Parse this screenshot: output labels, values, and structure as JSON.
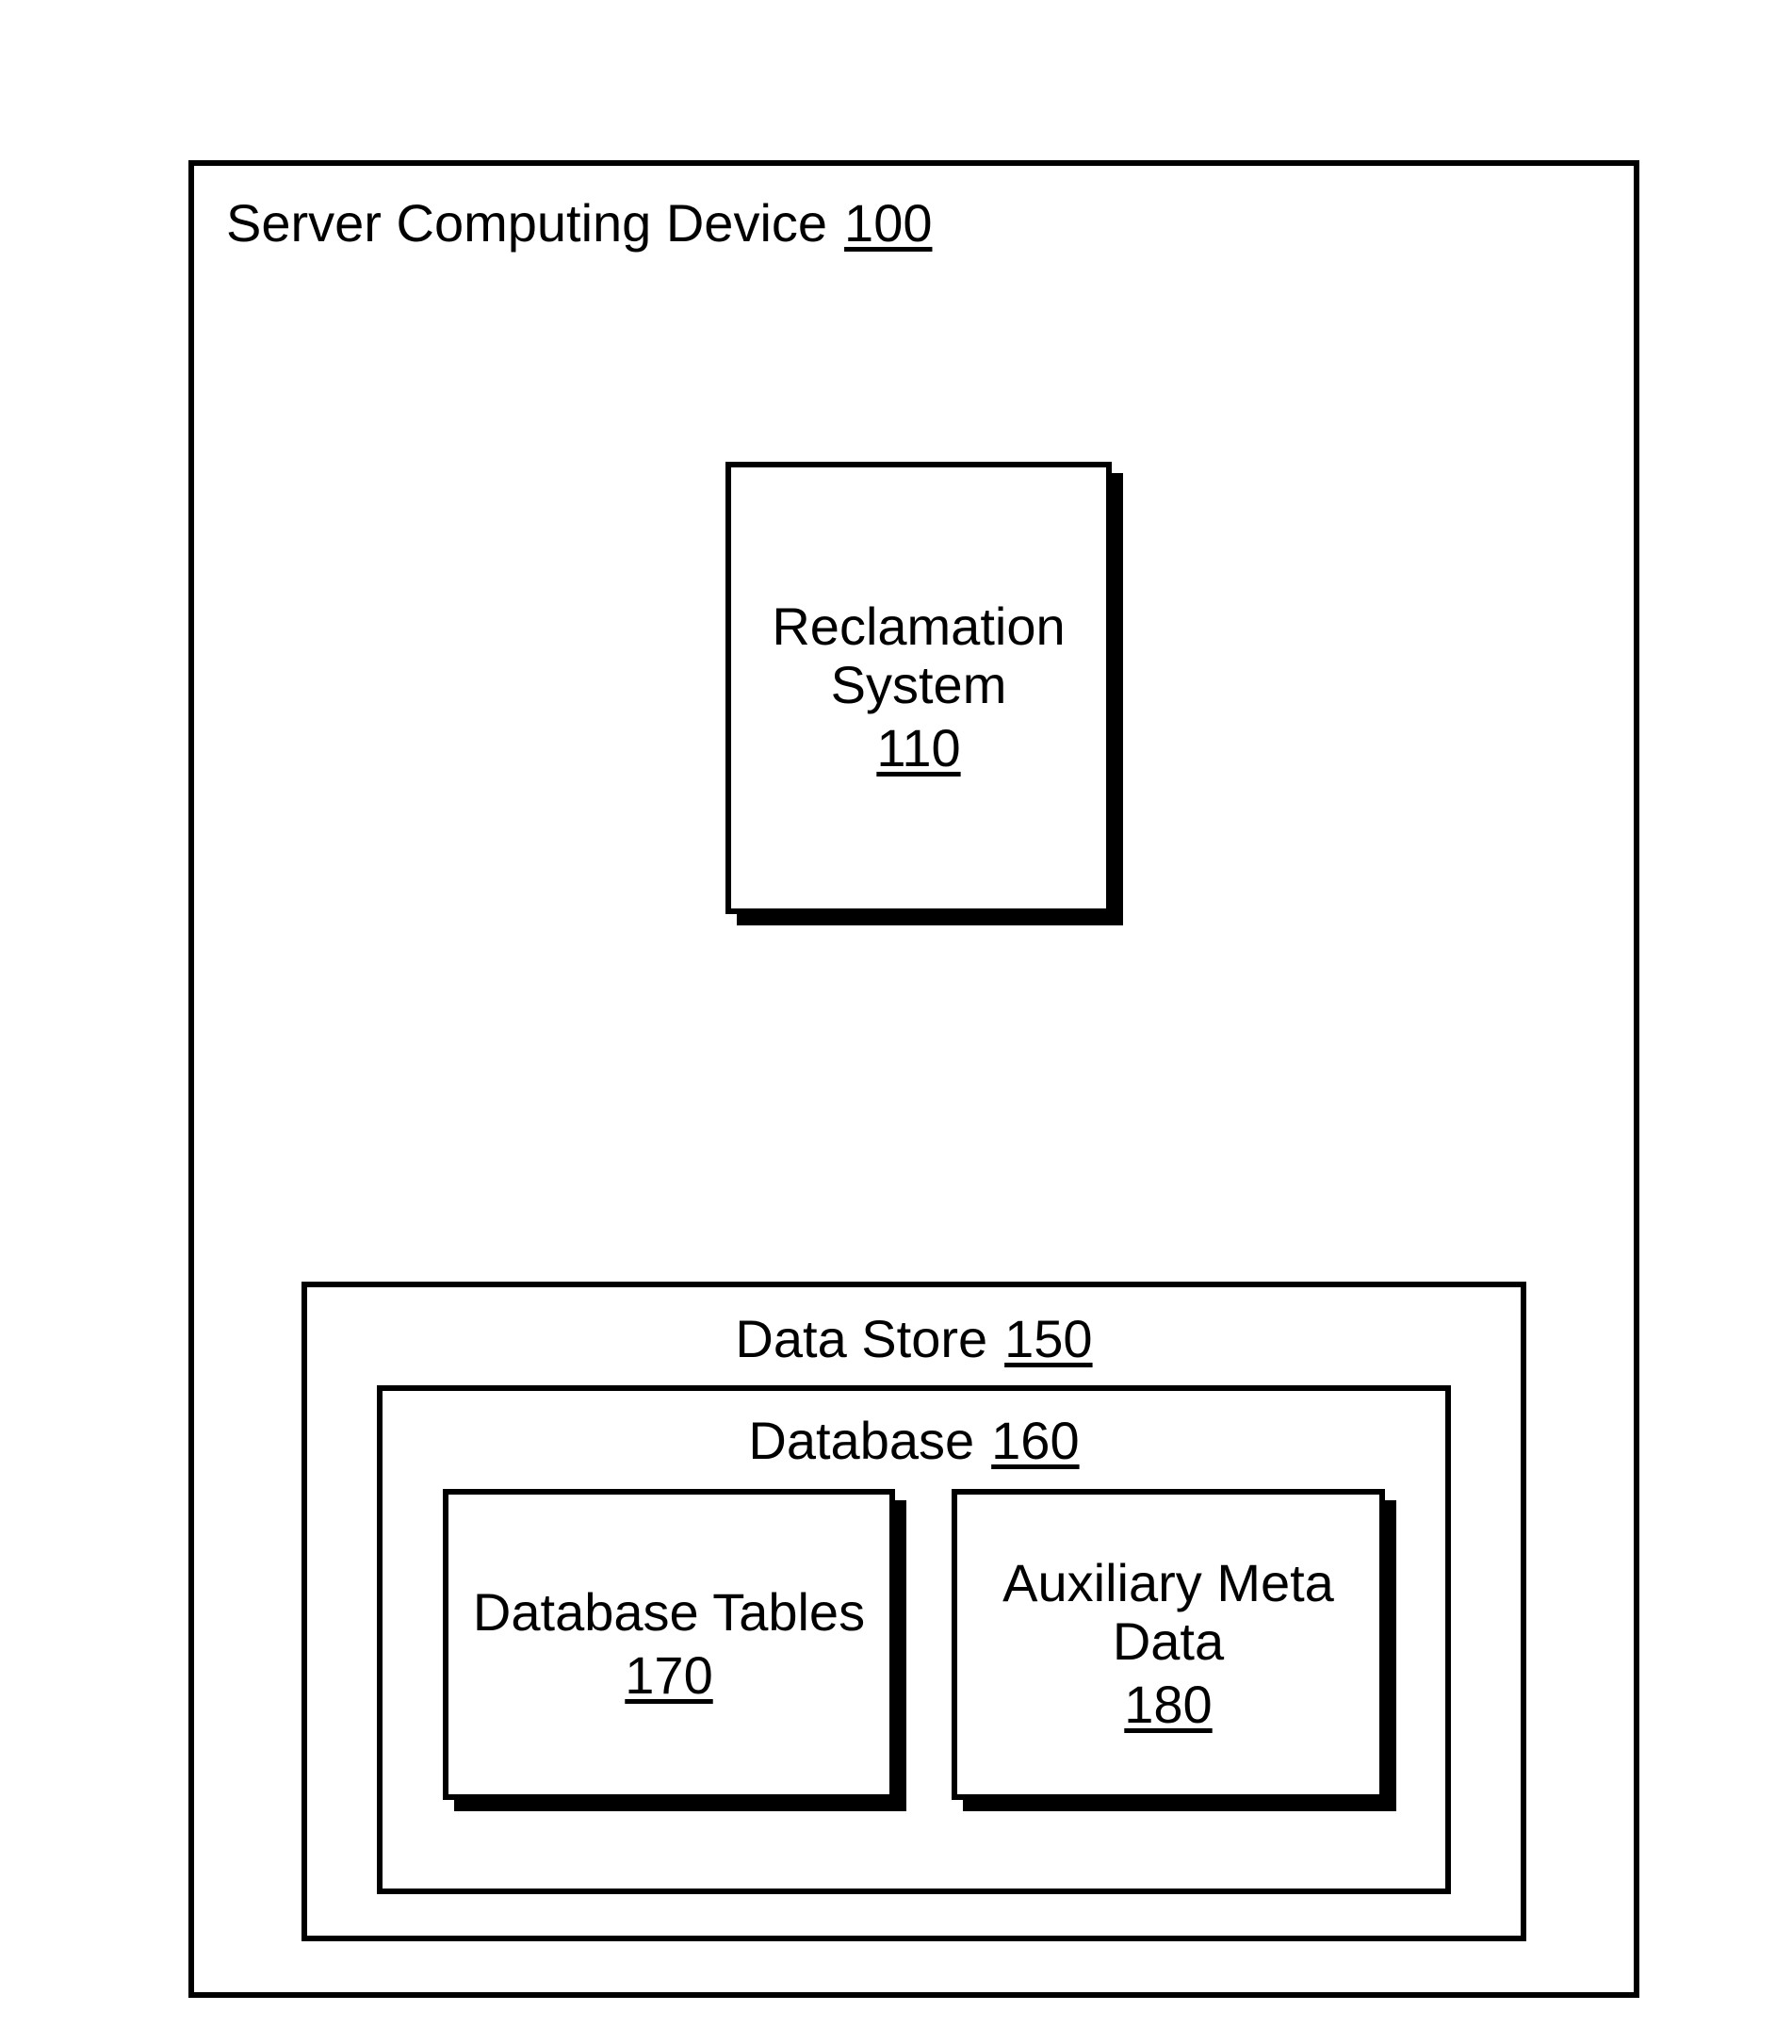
{
  "diagram": {
    "outer": {
      "label": "Server Computing Device",
      "ref": "100"
    },
    "reclamation": {
      "label_line1": "Reclamation",
      "label_line2": "System",
      "ref": "110"
    },
    "data_store": {
      "label": "Data Store",
      "ref": "150"
    },
    "database": {
      "label": "Database",
      "ref": "160"
    },
    "db_tables": {
      "label_line1": "Database Tables",
      "ref": "170"
    },
    "aux_meta": {
      "label_line1": "Auxiliary Meta",
      "label_line2": "Data",
      "ref": "180"
    }
  }
}
